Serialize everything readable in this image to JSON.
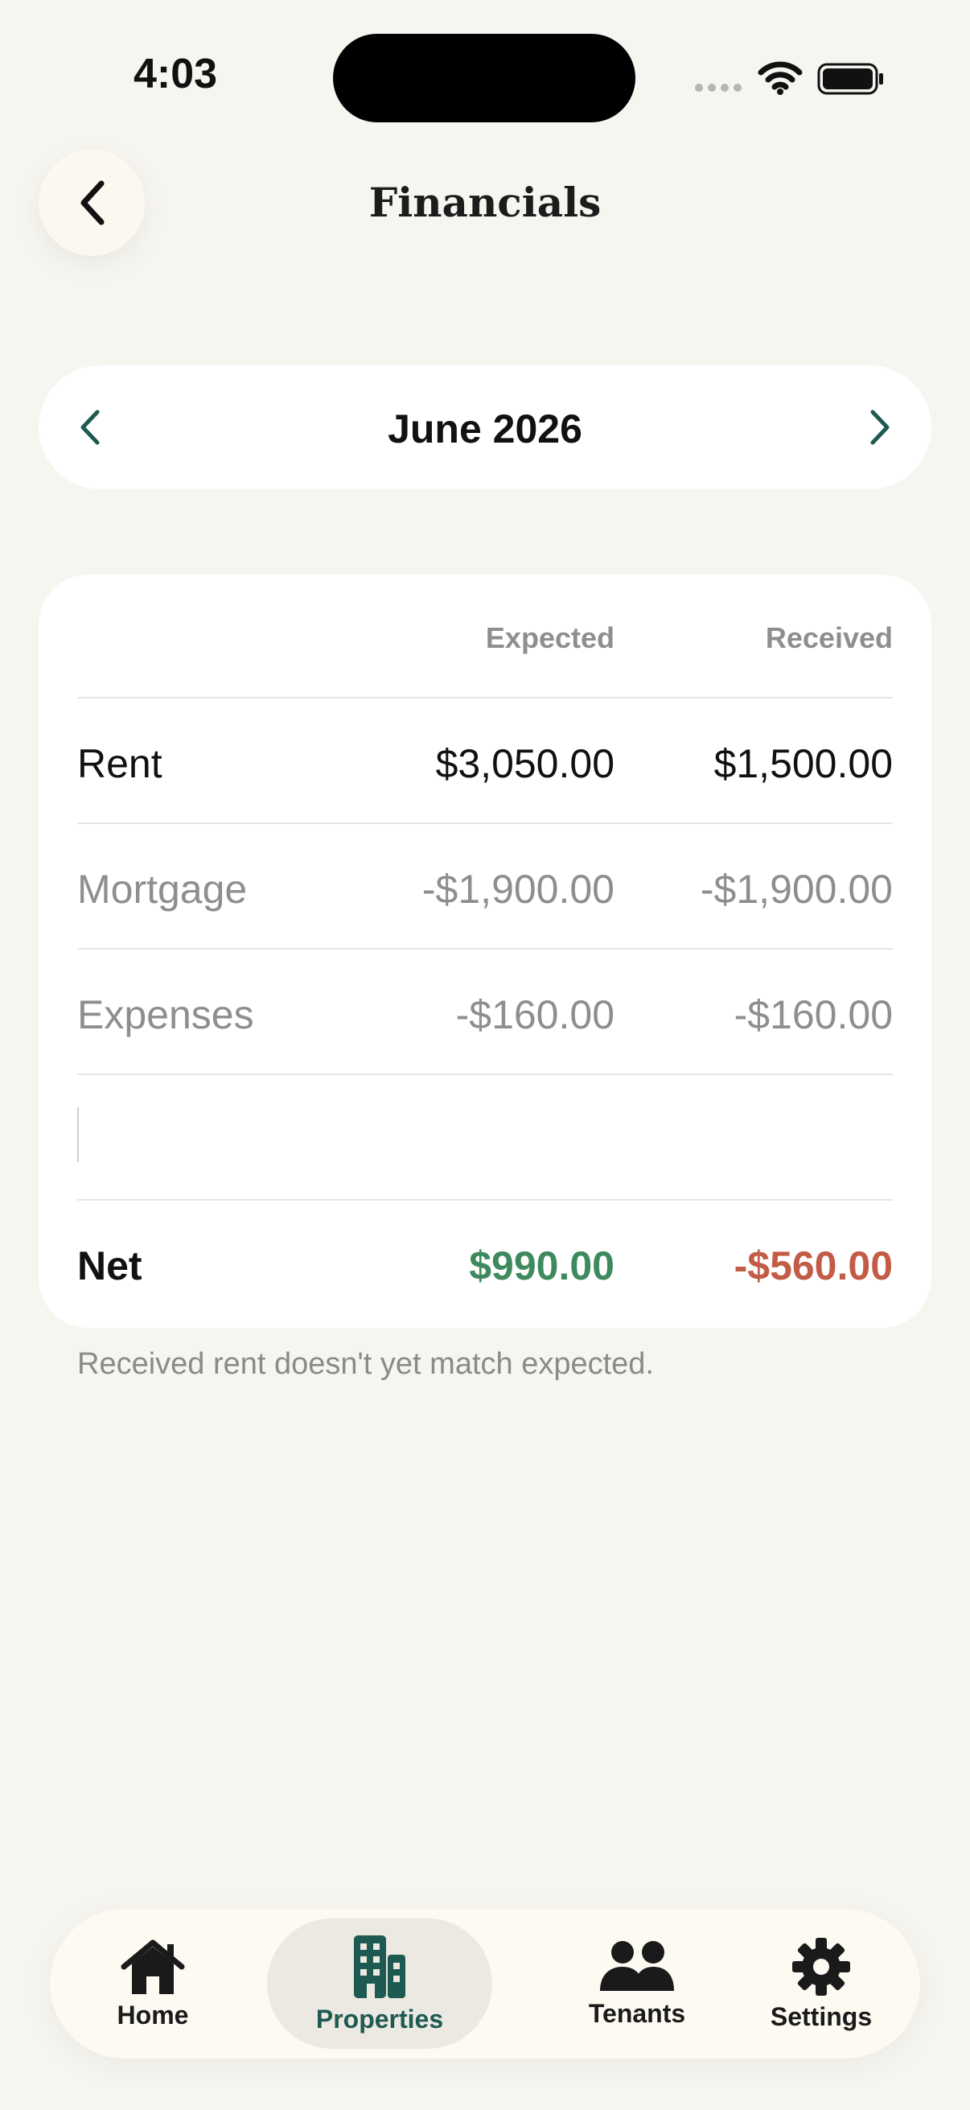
{
  "status_bar": {
    "time": "4:03"
  },
  "header": {
    "title": "Financials"
  },
  "month_selector": {
    "label": "June 2026"
  },
  "table": {
    "columns": [
      "Expected",
      "Received"
    ],
    "rows": [
      {
        "label": "Rent",
        "expected": "$3,050.00",
        "received": "$1,500.00"
      },
      {
        "label": "Mortgage",
        "expected": "-$1,900.00",
        "received": "-$1,900.00"
      },
      {
        "label": "Expenses",
        "expected": "-$160.00",
        "received": "-$160.00"
      }
    ],
    "net": {
      "label": "Net",
      "expected": "$990.00",
      "received": "-$560.00"
    }
  },
  "note": "Received rent doesn't yet match expected.",
  "tabs": [
    {
      "label": "Home",
      "icon": "house-icon"
    },
    {
      "label": "Properties",
      "icon": "building-icon",
      "active": true
    },
    {
      "label": "Tenants",
      "icon": "people-icon"
    },
    {
      "label": "Settings",
      "icon": "gear-icon"
    }
  ],
  "colors": {
    "background": "#f6f5f0",
    "accent": "#1e5a52",
    "positive": "#3e8a5e",
    "negative": "#c25c47"
  }
}
